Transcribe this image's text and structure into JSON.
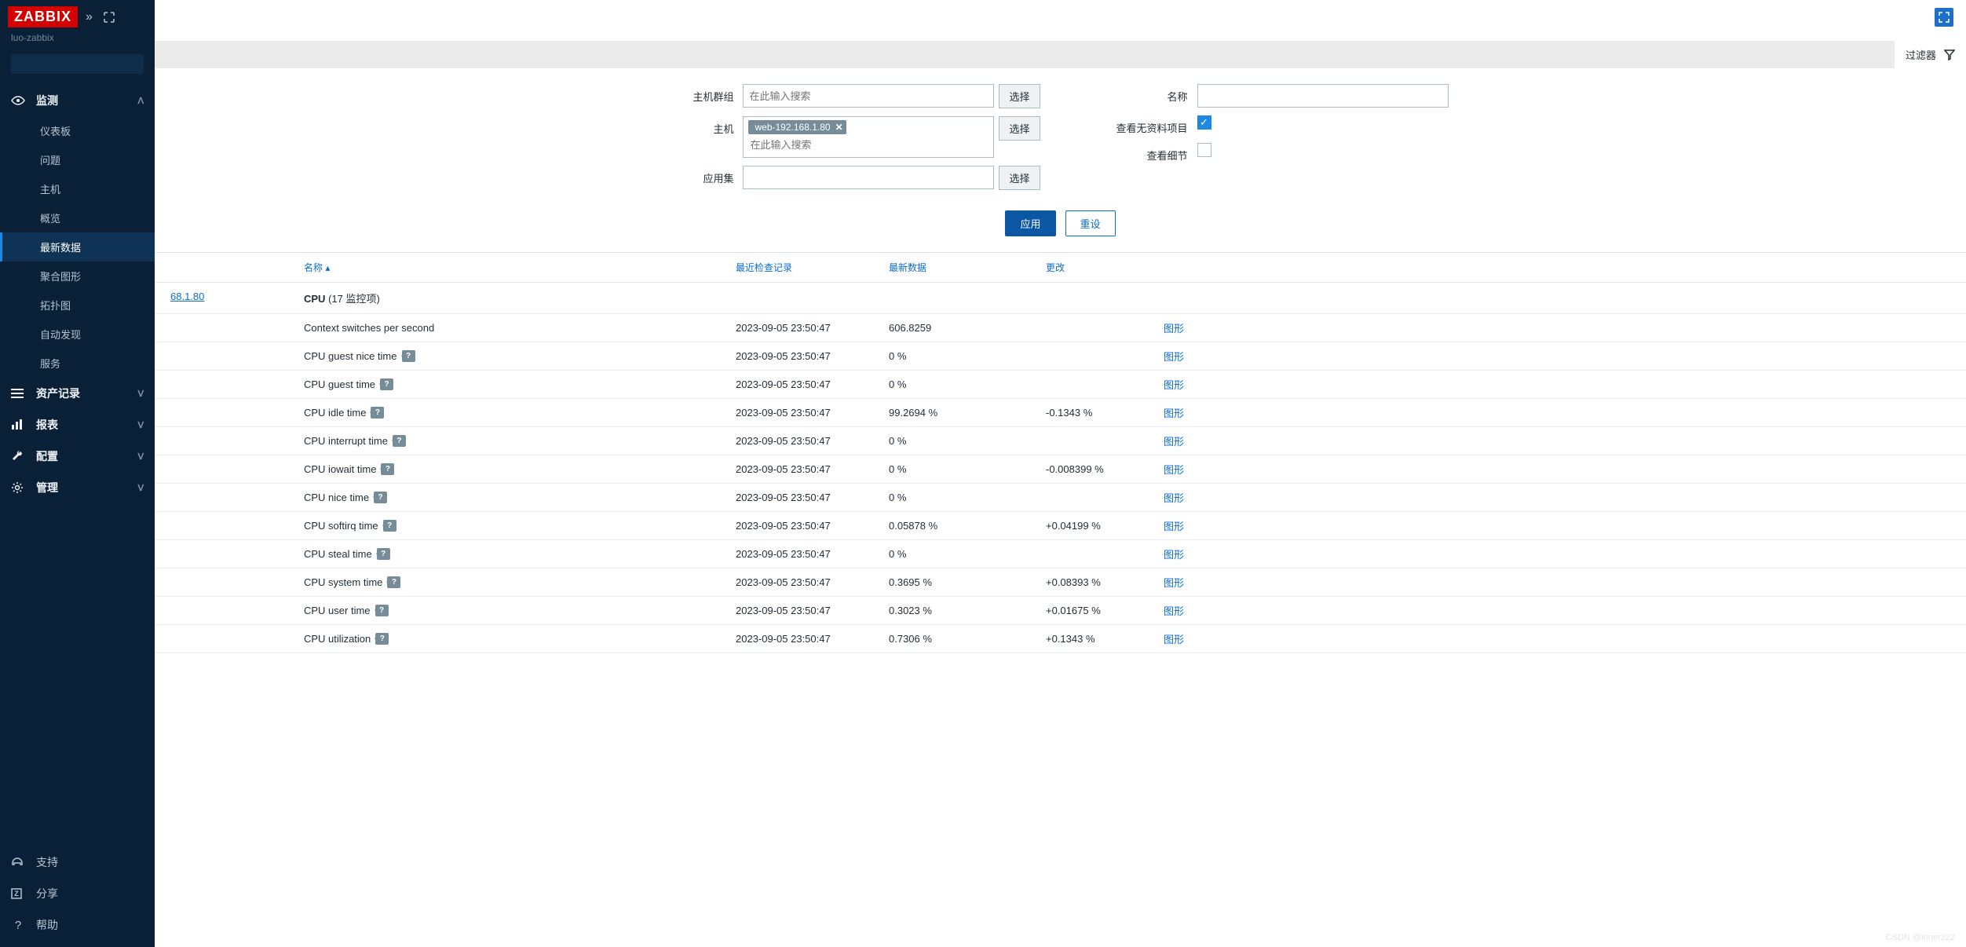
{
  "brand": "ZABBIX",
  "server_name": "luo-zabbix",
  "search_placeholder": "",
  "nav": {
    "monitoring": {
      "label": "监测",
      "expanded": true,
      "items": [
        {
          "label": "仪表板"
        },
        {
          "label": "问题"
        },
        {
          "label": "主机"
        },
        {
          "label": "概览"
        },
        {
          "label": "最新数据",
          "active": true
        },
        {
          "label": "聚合图形"
        },
        {
          "label": "拓扑图"
        },
        {
          "label": "自动发现"
        },
        {
          "label": "服务"
        }
      ]
    },
    "inventory": {
      "label": "资产记录"
    },
    "reports": {
      "label": "报表"
    },
    "config": {
      "label": "配置"
    },
    "admin": {
      "label": "管理"
    },
    "support": {
      "label": "支持"
    },
    "share": {
      "label": "分享"
    },
    "help": {
      "label": "帮助"
    }
  },
  "filter_tab": "过滤器",
  "filter": {
    "host_group_label": "主机群组",
    "host_group_placeholder": "在此输入搜索",
    "host_group_select": "选择",
    "host_label": "主机",
    "host_tag": "web-192.168.1.80",
    "host_placeholder": "在此输入搜索",
    "host_select": "选择",
    "app_label": "应用集",
    "app_select": "选择",
    "name_label": "名称",
    "show_nodata_label": "查看无资料项目",
    "show_nodata_checked": true,
    "show_detail_label": "查看细节",
    "show_detail_checked": false,
    "apply": "应用",
    "reset": "重设"
  },
  "columns": {
    "name": "名称",
    "last_check": "最近检查记录",
    "last_value": "最新数据",
    "change": "更改"
  },
  "group": {
    "host_link": "68.1.80",
    "app": "CPU",
    "count_text": "(17 监控项)"
  },
  "action_label": "图形",
  "rows": [
    {
      "name": "Context switches per second",
      "help": false,
      "time": "2023-09-05 23:50:47",
      "value": "606.8259",
      "change": ""
    },
    {
      "name": "CPU guest nice time",
      "help": true,
      "time": "2023-09-05 23:50:47",
      "value": "0 %",
      "change": ""
    },
    {
      "name": "CPU guest time",
      "help": true,
      "time": "2023-09-05 23:50:47",
      "value": "0 %",
      "change": ""
    },
    {
      "name": "CPU idle time",
      "help": true,
      "time": "2023-09-05 23:50:47",
      "value": "99.2694 %",
      "change": "-0.1343 %"
    },
    {
      "name": "CPU interrupt time",
      "help": true,
      "time": "2023-09-05 23:50:47",
      "value": "0 %",
      "change": ""
    },
    {
      "name": "CPU iowait time",
      "help": true,
      "time": "2023-09-05 23:50:47",
      "value": "0 %",
      "change": "-0.008399 %"
    },
    {
      "name": "CPU nice time",
      "help": true,
      "time": "2023-09-05 23:50:47",
      "value": "0 %",
      "change": ""
    },
    {
      "name": "CPU softirq time",
      "help": true,
      "time": "2023-09-05 23:50:47",
      "value": "0.05878 %",
      "change": "+0.04199 %"
    },
    {
      "name": "CPU steal time",
      "help": true,
      "time": "2023-09-05 23:50:47",
      "value": "0 %",
      "change": ""
    },
    {
      "name": "CPU system time",
      "help": true,
      "time": "2023-09-05 23:50:47",
      "value": "0.3695 %",
      "change": "+0.08393 %"
    },
    {
      "name": "CPU user time",
      "help": true,
      "time": "2023-09-05 23:50:47",
      "value": "0.3023 %",
      "change": "+0.01675 %"
    },
    {
      "name": "CPU utilization",
      "help": true,
      "time": "2023-09-05 23:50:47",
      "value": "0.7306 %",
      "change": "+0.1343 %"
    }
  ],
  "watermark": "CSDN @inner222"
}
